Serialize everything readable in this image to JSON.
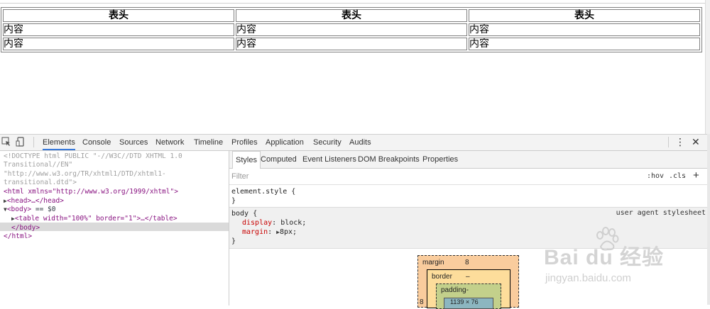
{
  "page_table": {
    "headers": [
      "表头",
      "表头",
      "表头"
    ],
    "rows": [
      [
        "内容",
        "内容",
        "内容"
      ],
      [
        "内容",
        "内容",
        "内容"
      ]
    ]
  },
  "devtools": {
    "tabs": [
      "Elements",
      "Console",
      "Sources",
      "Network",
      "Timeline",
      "Profiles",
      "Application",
      "Security",
      "Audits"
    ],
    "active_tab": "Elements",
    "icons": {
      "inspect": "cursor-arrow-icon",
      "device": "mobile-device-icon",
      "more": "vertical-dots-icon",
      "close": "close-icon"
    },
    "dom": {
      "doctype_1": "<!DOCTYPE html PUBLIC \"-//W3C//DTD XHTML 1.0",
      "doctype_2": "Transitional//EN\"",
      "doctype_3": "\"http://www.w3.org/TR/xhtml1/DTD/xhtml1-",
      "doctype_4": "transitional.dtd\">",
      "html_open": "<html xmlns=\"http://www.w3.org/1999/xhtml\">",
      "head": "<head>…</head>",
      "body_open": "<body>",
      "body_suffix": " == $0",
      "table_line": "<table width=\"100%\" border=\"1\">…</table>",
      "body_close": "</body>",
      "html_close": "</html>"
    },
    "styles": {
      "subtabs": [
        "Styles",
        "Computed",
        "Event Listeners",
        "DOM Breakpoints",
        "Properties"
      ],
      "active_subtab": "Styles",
      "filter_placeholder": "Filter",
      "hov": ":hov",
      "cls": ".cls",
      "plus": "+",
      "element_style_open": "element.style {",
      "element_style_close": "}",
      "body_rule_selector": "body {",
      "ua_label": "user agent stylesheet",
      "prop1_name": "display",
      "prop1_value": "block;",
      "prop2_name": "margin",
      "prop2_value": "8px;",
      "body_rule_close": "}"
    },
    "box_model": {
      "margin_label": "margin",
      "margin_value": "8",
      "border_label": "border",
      "border_value": "–",
      "padding_label": "padding-",
      "content_value": "1139 × 76",
      "margin_left_value": "8"
    }
  },
  "watermark": {
    "main": "Bai du 经验",
    "sub": "jingyan.baidu.com"
  },
  "colors": {
    "accent": "#3879d9",
    "tag": "#881280",
    "attr": "#994500",
    "value": "#1a1aa6",
    "property": "#c80000"
  }
}
